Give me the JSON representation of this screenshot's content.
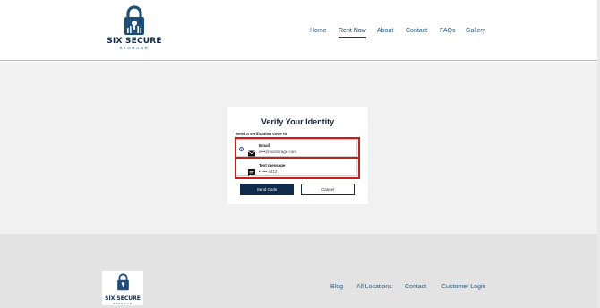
{
  "brand": {
    "name": "SIX SECURE",
    "tagline": "STORAGE",
    "primary_color": "#0f2a4a",
    "accent_color": "#1c4f7d"
  },
  "nav": {
    "items": [
      {
        "label": "Home"
      },
      {
        "label": "Rent Now",
        "active": true
      },
      {
        "label": "About"
      },
      {
        "label": "Contact"
      },
      {
        "label": "FAQs"
      },
      {
        "label": "Gallery"
      }
    ]
  },
  "verify": {
    "title": "Verify Your Identity",
    "subtitle": "Send a verification code to",
    "options": [
      {
        "label": "Email",
        "value": "e•••@sixstorage.com",
        "icon": "envelope-icon",
        "selected": true
      },
      {
        "label": "Text message",
        "value": "•• ••• 4412",
        "icon": "message-icon",
        "selected": false
      }
    ],
    "send_label": "Send Code",
    "cancel_label": "Cancel"
  },
  "footer": {
    "links": [
      {
        "label": "Blog"
      },
      {
        "label": "All Locations"
      },
      {
        "label": "Contact"
      },
      {
        "label": "Customer Login"
      }
    ]
  },
  "highlight_color": "#d11a1a"
}
